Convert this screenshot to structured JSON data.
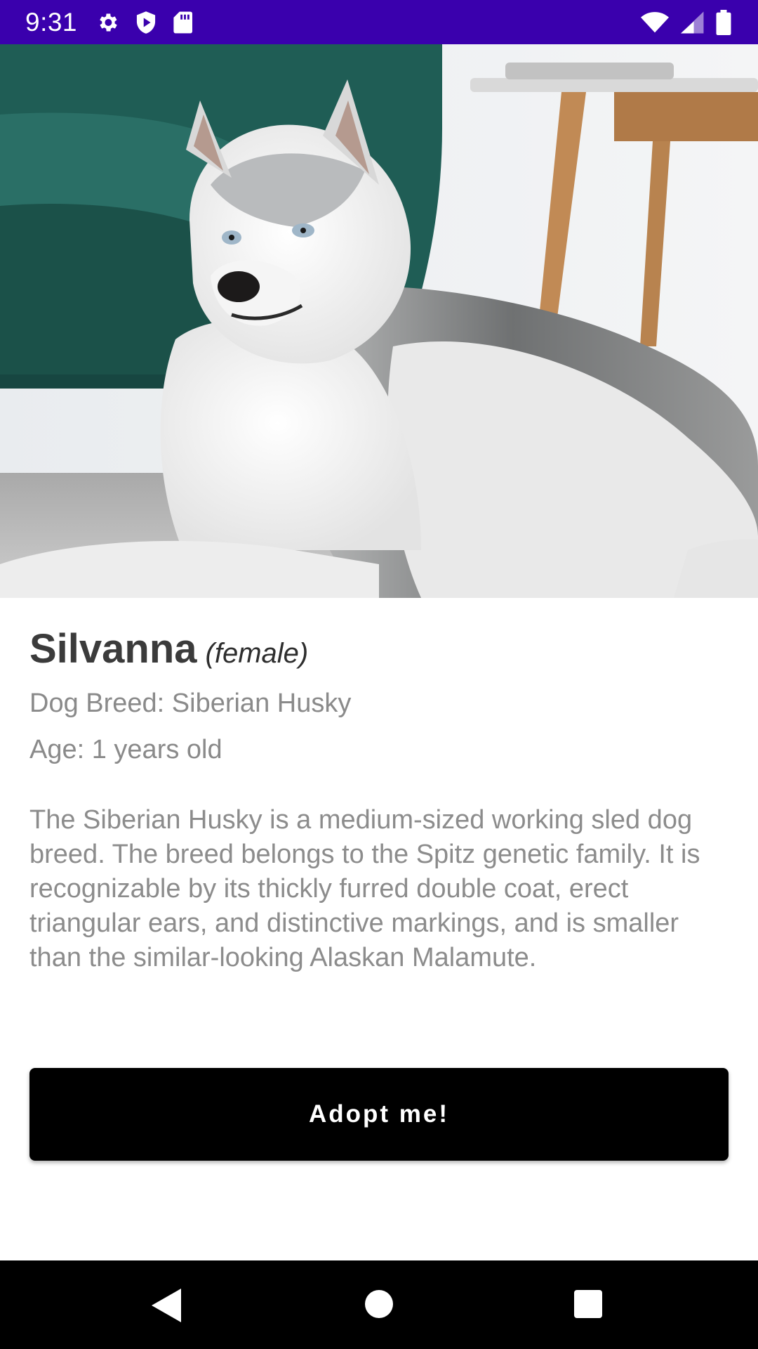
{
  "status_bar": {
    "time": "9:31",
    "icons_left": [
      "settings-icon",
      "shield-play-icon",
      "sd-card-icon"
    ],
    "icons_right": [
      "wifi-icon",
      "signal-icon",
      "battery-icon"
    ],
    "background": "#3a00ad"
  },
  "hero": {
    "image": "siberian-husky-photo"
  },
  "dog": {
    "name": "Silvanna",
    "gender": "(female)",
    "breed_line": "Dog Breed: Siberian Husky",
    "age_line": "Age: 1 years old",
    "description": "The Siberian Husky is a medium-sized working sled dog breed. The breed belongs to the Spitz genetic family. It is recognizable by its thickly furred double coat, erect triangular ears, and distinctive markings, and is smaller than the similar-looking Alaskan Malamute."
  },
  "actions": {
    "adopt_label": "Adopt me!"
  },
  "nav_bar": {
    "buttons": [
      "back-icon",
      "home-icon",
      "recents-icon"
    ]
  }
}
